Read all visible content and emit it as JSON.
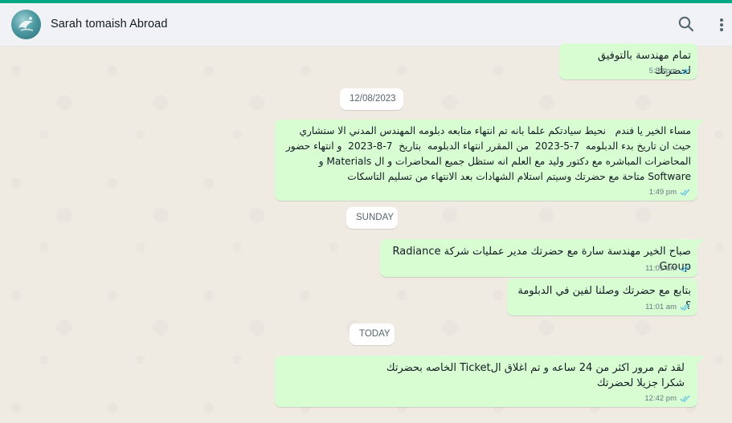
{
  "header": {
    "contact_name": "Sarah tomaish Abroad",
    "search_icon": "search-icon",
    "menu_icon": "vertical-dots-menu-icon"
  },
  "colors": {
    "accent": "#00a884",
    "outgoing_bubble": "#d9fdd3",
    "chat_background": "#efeae2",
    "read_ticks": "#53bdeb"
  },
  "messages": [
    {
      "text": "تمام مهندسة بالتوفيق لحضرتك",
      "time": "5:59 pm",
      "status": "read"
    },
    {
      "text": "مساء الخير يا فندم   نحيط سيادتكم علما بانه تم انتهاء متابعه دبلومه المهندس المدني الا ستشاري\nحيث ان تاريخ بدء الدبلومه  7-5-2023  من المقرر انتهاء الدبلومه  بتاريخ  7-8-2023  و انتهاء حضور\nالمحاضرات المباشره مع دكتور وليد مع العلم انه ستظل جميع المحاضرات و ال Materials و\nSoftware متاحة مع حضرتك وسيتم استلام الشهادات بعد الانتهاء من تسليم التاسكات",
      "time": "1:49 pm",
      "status": "read"
    },
    {
      "text": "صباح الخير مهندسة سارة مع حضرتك مدير عمليات شركة Radiance Group",
      "time": "11:01 am",
      "status": "read"
    },
    {
      "text": "بتابع مع حضرتك وصلنا لفين في الدبلومة ؟",
      "time": "11:01 am",
      "status": "read"
    },
    {
      "text": "لقد تم مرور اكثر من 24 ساعه و تم اغلاق الTicket الخاصه بحضرتك\nشكرا جزيلا لحضرتك",
      "time": "12:42 pm",
      "status": "read"
    }
  ],
  "date_separators": [
    "12/08/2023",
    "SUNDAY",
    "TODAY"
  ]
}
